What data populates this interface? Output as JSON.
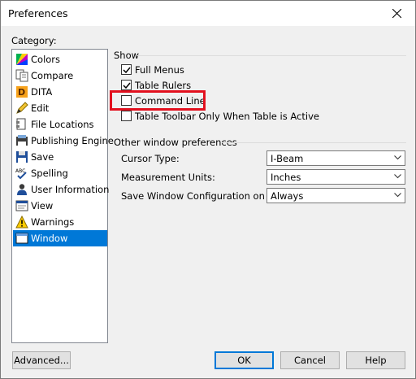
{
  "window": {
    "title": "Preferences"
  },
  "category": {
    "label": "Category:",
    "items": [
      {
        "label": "Colors",
        "icon": "colors-icon"
      },
      {
        "label": "Compare",
        "icon": "compare-icon"
      },
      {
        "label": "DITA",
        "icon": "dita-icon"
      },
      {
        "label": "Edit",
        "icon": "pencil-icon"
      },
      {
        "label": "File Locations",
        "icon": "file-locations-icon"
      },
      {
        "label": "Publishing Engine",
        "icon": "publishing-engine-icon"
      },
      {
        "label": "Save",
        "icon": "floppy-disk-icon"
      },
      {
        "label": "Spelling",
        "icon": "spelling-icon"
      },
      {
        "label": "User Information",
        "icon": "user-icon"
      },
      {
        "label": "View",
        "icon": "eye-icon"
      },
      {
        "label": "Warnings",
        "icon": "warning-icon"
      },
      {
        "label": "Window",
        "icon": "window-icon"
      }
    ],
    "selected": "Window"
  },
  "show": {
    "title": "Show",
    "options": [
      {
        "label": "Full Menus",
        "checked": true
      },
      {
        "label": "Table Rulers",
        "checked": true
      },
      {
        "label": "Command Line",
        "checked": false
      },
      {
        "label": "Table Toolbar Only When Table is Active",
        "checked": false
      }
    ]
  },
  "other": {
    "title": "Other window preferences",
    "fields": [
      {
        "label": "Cursor Type:",
        "value": "I-Beam"
      },
      {
        "label": "Measurement Units:",
        "value": "Inches"
      },
      {
        "label": "Save Window Configuration on Exit:",
        "value": "Always"
      }
    ]
  },
  "buttons": {
    "advanced": "Advanced...",
    "ok": "OK",
    "cancel": "Cancel",
    "help": "Help"
  },
  "colors": {
    "selection": "#0078d7",
    "highlight_box": "#e2101e",
    "default_button_border": "#0078d7"
  }
}
